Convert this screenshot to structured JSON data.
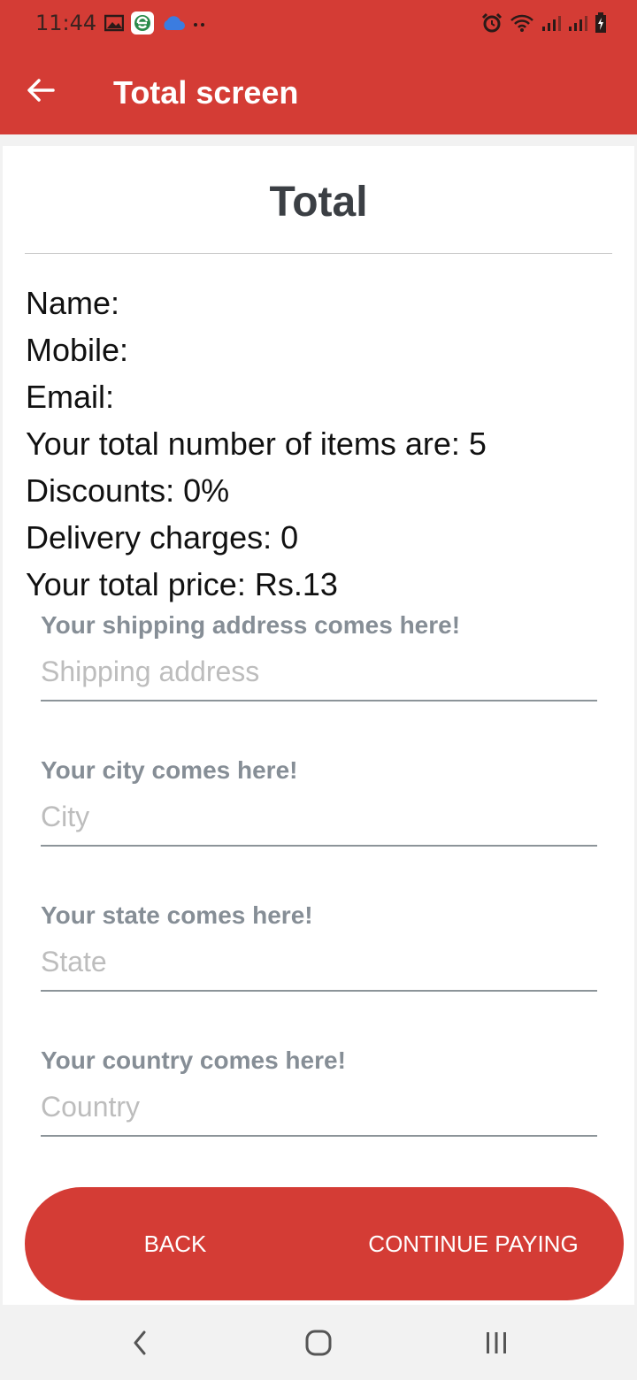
{
  "status_bar": {
    "time": "11:44",
    "icons_left": [
      "gallery-icon",
      "app-e-icon",
      "cloud-icon",
      "more-dots-icon"
    ],
    "icons_right": [
      "alarm-icon",
      "wifi-icon",
      "signal-icon",
      "signal-icon",
      "battery-charging-icon"
    ]
  },
  "app_bar": {
    "title": "Total screen",
    "back_icon": "arrow-left-icon"
  },
  "card": {
    "title": "Total",
    "info": {
      "name": "Name:",
      "mobile": "Mobile:",
      "email": "Email:",
      "items": "Your total number of items are: 5",
      "discounts": "Discounts: 0%",
      "delivery": "Delivery charges: 0",
      "price": "Your total price: Rs.13"
    },
    "fields": [
      {
        "label": "Your shipping address comes here!",
        "placeholder": "Shipping address",
        "value": ""
      },
      {
        "label": "Your city comes here!",
        "placeholder": "City",
        "value": ""
      },
      {
        "label": "Your state comes here!",
        "placeholder": "State",
        "value": ""
      },
      {
        "label": "Your country comes here!",
        "placeholder": "Country",
        "value": ""
      }
    ]
  },
  "buttons": {
    "back": "BACK",
    "continue": "CONTINUE PAYING"
  },
  "nav": {
    "back_icon": "chevron-left-icon",
    "home_icon": "home-rounded-square-icon",
    "recents_icon": "recents-bars-icon"
  },
  "colors": {
    "primary": "#d43c35",
    "label_gray": "#868e96",
    "placeholder_gray": "#bdbdbd",
    "title_dark": "#3b3f44"
  }
}
